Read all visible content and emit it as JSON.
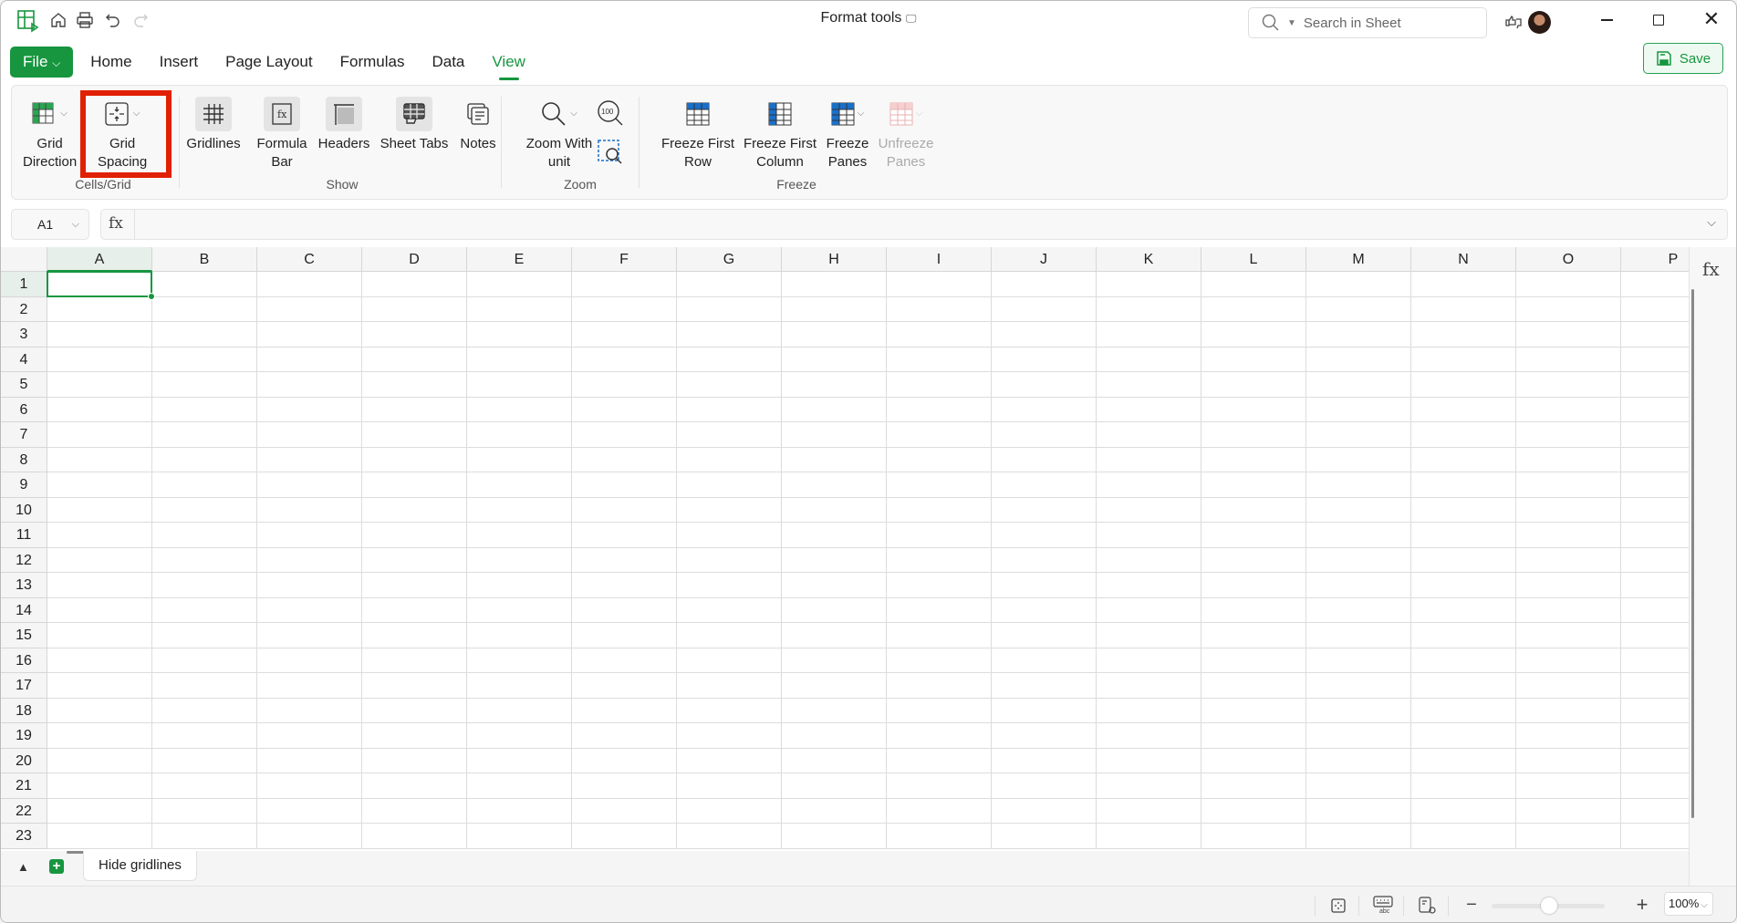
{
  "window": {
    "title": "Format tools"
  },
  "search": {
    "placeholder": "Search in Sheet"
  },
  "menu_tabs": [
    {
      "label": "File"
    },
    {
      "label": "Home"
    },
    {
      "label": "Insert"
    },
    {
      "label": "Page Layout"
    },
    {
      "label": "Formulas"
    },
    {
      "label": "Data"
    },
    {
      "label": "View"
    }
  ],
  "save_label": "Save",
  "ribbon": {
    "groups": {
      "cells_grid": "Cells/Grid",
      "show": "Show",
      "zoom": "Zoom",
      "freeze": "Freeze"
    },
    "grid_direction": [
      "Grid",
      "Direction"
    ],
    "grid_spacing": [
      "Grid",
      "Spacing"
    ],
    "gridlines": "Gridlines",
    "formula_bar": [
      "Formula",
      "Bar"
    ],
    "headers": "Headers",
    "sheet_tabs": "Sheet Tabs",
    "notes": "Notes",
    "zoom_with_unit": [
      "Zoom With",
      "unit"
    ],
    "zoom_100": "100",
    "freeze_first_row": [
      "Freeze First",
      "Row"
    ],
    "freeze_first_column": [
      "Freeze First",
      "Column"
    ],
    "freeze_panes": [
      "Freeze",
      "Panes"
    ],
    "unfreeze_panes": [
      "Unfreeze",
      "Panes"
    ]
  },
  "formula_bar": {
    "cell_ref": "A1",
    "fx": "fx",
    "value": ""
  },
  "columns": [
    "A",
    "B",
    "C",
    "D",
    "E",
    "F",
    "G",
    "H",
    "I",
    "J",
    "K",
    "L",
    "M",
    "N",
    "O",
    "P"
  ],
  "rows": [
    "1",
    "2",
    "3",
    "4",
    "5",
    "6",
    "7",
    "8",
    "9",
    "10",
    "11",
    "12",
    "13",
    "14",
    "15",
    "16",
    "17",
    "18",
    "19",
    "20",
    "21",
    "22",
    "23"
  ],
  "selected_cell": "A1",
  "sheets": [
    {
      "name": "Hide gridlines"
    }
  ],
  "status": {
    "zoom": "100%",
    "zoom_percent": 100
  },
  "colors": {
    "accent": "#17963f",
    "highlight": "#e02000"
  }
}
